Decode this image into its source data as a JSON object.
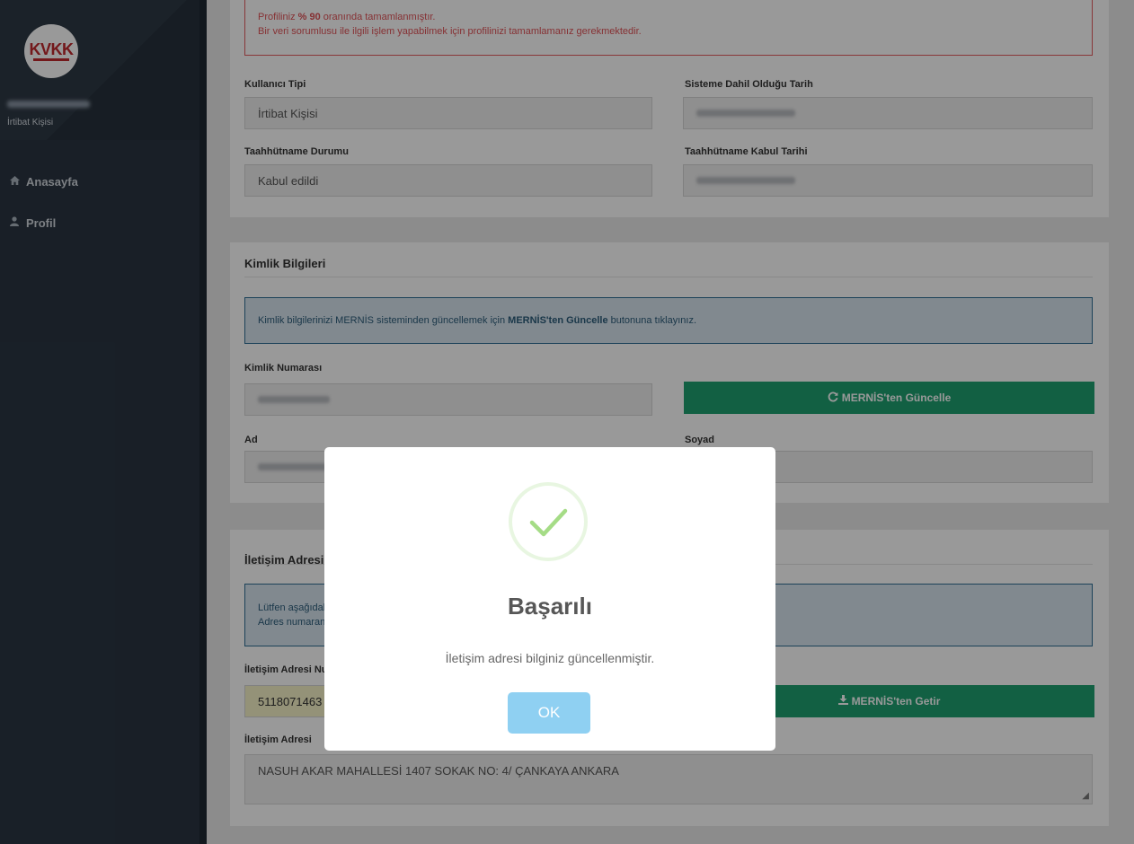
{
  "sidebar": {
    "logo_text": "KVKK",
    "user_role": "İrtibat Kişisi",
    "nav": [
      {
        "icon": "home-icon",
        "label": "Anasayfa"
      },
      {
        "icon": "user-icon",
        "label": "Profil"
      }
    ]
  },
  "profile_panel": {
    "alert_prefix": "Profiliniz ",
    "alert_percent": "% 90",
    "alert_suffix": " oranında tamamlanmıştır.",
    "alert_line2": "Bir veri sorumlusu ile ilgili işlem yapabilmek için profilinizi tamamlamanız gerekmektedir.",
    "user_type_label": "Kullanıcı Tipi",
    "user_type_value": "İrtibat Kişisi",
    "join_date_label": "Sisteme Dahil Olduğu Tarih",
    "commitment_status_label": "Taahhütname Durumu",
    "commitment_status_value": "Kabul edildi",
    "commitment_date_label": "Taahhütname Kabul Tarihi"
  },
  "identity_panel": {
    "title": "Kimlik Bilgileri",
    "info_prefix": "Kimlik bilgilerinizi MERNİS sisteminden güncellemek için ",
    "info_bold": "MERNİS'ten Güncelle",
    "info_suffix": " butonuna tıklayınız.",
    "id_number_label": "Kimlik Numarası",
    "mernis_update_button": "MERNİS'ten Güncelle",
    "first_name_label": "Ad",
    "last_name_label": "Soyad"
  },
  "address_panel": {
    "title": "İletişim Adresi",
    "info_line1": "Lütfen aşağıdaki alana adres numaranızı girerek MERNİS'ten Getir butonuna tıklayınız.",
    "info_line2": "Adres numaranızı e-Devlet üzerinden Adres Bilgilerim hizmetini kullanmak suretiyle öğrenebilirsiniz.",
    "address_no_label": "İletişim Adresi Numarası",
    "address_no_value": "5118071463",
    "mernis_fetch_button": "MERNİS'ten Getir",
    "address_label": "İletişim Adresi",
    "address_value": "NASUH AKAR  MAHALLESİ 1407 SOKAK NO: 4/ ÇANKAYA ANKARA"
  },
  "modal": {
    "title": "Başarılı",
    "message": "İletişim adresi bilginiz güncellenmiştir.",
    "ok_button": "OK"
  },
  "colors": {
    "sidebar": "#2a3542",
    "danger": "#e05257",
    "info_border": "#2f6f94",
    "green_button": "#1fa171",
    "success_check": "#a5dc86",
    "ok_button": "#8fd0f2"
  }
}
